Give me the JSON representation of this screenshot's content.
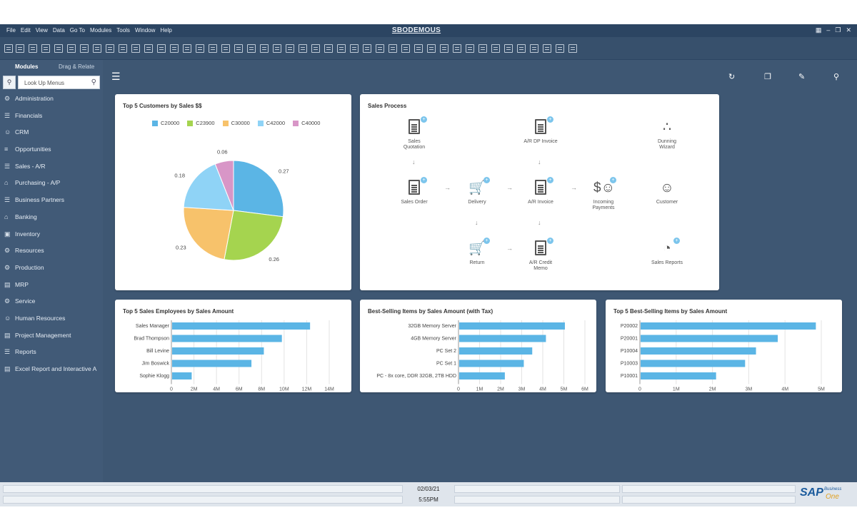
{
  "window": {
    "title": "SBODEMOUS",
    "menu": [
      "File",
      "Edit",
      "View",
      "Data",
      "Go To",
      "Modules",
      "Tools",
      "Window",
      "Help"
    ]
  },
  "sidebar": {
    "tabs": [
      "Modules",
      "Drag & Relate"
    ],
    "search_placeholder": "Look Up Menus",
    "items": [
      {
        "label": "Administration",
        "icon": "gear-icon"
      },
      {
        "label": "Financials",
        "icon": "ledger-icon"
      },
      {
        "label": "CRM",
        "icon": "people-icon"
      },
      {
        "label": "Opportunities",
        "icon": "chart-icon"
      },
      {
        "label": "Sales - A/R",
        "icon": "sales-icon"
      },
      {
        "label": "Purchasing - A/P",
        "icon": "cart-icon"
      },
      {
        "label": "Business Partners",
        "icon": "partners-icon"
      },
      {
        "label": "Banking",
        "icon": "bank-icon"
      },
      {
        "label": "Inventory",
        "icon": "box-icon"
      },
      {
        "label": "Resources",
        "icon": "resources-icon"
      },
      {
        "label": "Production",
        "icon": "production-icon"
      },
      {
        "label": "MRP",
        "icon": "mrp-icon"
      },
      {
        "label": "Service",
        "icon": "service-icon"
      },
      {
        "label": "Human Resources",
        "icon": "person-icon"
      },
      {
        "label": "Project Management",
        "icon": "project-icon"
      },
      {
        "label": "Reports",
        "icon": "report-icon"
      },
      {
        "label": "Excel Report and Interactive A",
        "icon": "excel-icon"
      }
    ]
  },
  "cards": {
    "pie": {
      "title": "Top 5 Customers by Sales $$"
    },
    "process": {
      "title": "Sales Process"
    },
    "employees": {
      "title": "Top 5 Sales Employees by Sales Amount"
    },
    "items_tax": {
      "title": "Best-Selling Items by Sales Amount (with Tax)"
    },
    "items": {
      "title": "Top 5 Best-Selling Items by Sales Amount"
    }
  },
  "process": {
    "nodes": [
      {
        "id": "quotation",
        "label": "Sales\nQuotation",
        "icon": "document-icon"
      },
      {
        "id": "ardp",
        "label": "A/R DP Invoice",
        "icon": "dollar-document-icon"
      },
      {
        "id": "dunning",
        "label": "Dunning\nWizard",
        "icon": "dunning-icon"
      },
      {
        "id": "order",
        "label": "Sales Order",
        "icon": "document-icon"
      },
      {
        "id": "delivery",
        "label": "Delivery",
        "icon": "cart-icon"
      },
      {
        "id": "arinvoice",
        "label": "A/R Invoice",
        "icon": "dollar-document-icon"
      },
      {
        "id": "incoming",
        "label": "Incoming\nPayments",
        "icon": "payment-icon"
      },
      {
        "id": "customer",
        "label": "Customer",
        "icon": "customer-icon"
      },
      {
        "id": "return",
        "label": "Return",
        "icon": "cart-return-icon"
      },
      {
        "id": "credit",
        "label": "A/R Credit\nMemo",
        "icon": "calendar-document-icon"
      },
      {
        "id": "reports",
        "label": "Sales Reports",
        "icon": "pie-report-icon"
      }
    ]
  },
  "status": {
    "date": "02/03/21",
    "time": "5:55PM"
  },
  "brand": {
    "sap": "SAP",
    "business": "Business",
    "one": "One"
  },
  "colors": {
    "bar": "#5bb5e5",
    "pie": [
      "#5bb5e5",
      "#a5d44f",
      "#f7c26b",
      "#8fd3f6",
      "#d896c7"
    ]
  },
  "chart_data": [
    {
      "type": "pie",
      "title": "Top 5 Customers by Sales $$",
      "categories": [
        "C20000",
        "C23900",
        "C30000",
        "C42000",
        "C40000"
      ],
      "values": [
        0.27,
        0.26,
        0.23,
        0.18,
        0.06
      ],
      "labels": [
        "0.27",
        "0.26",
        "0.23",
        "0.18",
        "0.06"
      ],
      "legend": "top"
    },
    {
      "type": "bar",
      "orientation": "horizontal",
      "title": "Top 5 Sales Employees by Sales Amount",
      "categories": [
        "Sales Manager",
        "Brad Thompson",
        "Bill Levine",
        "Jim Boswick",
        "Sophie Klogg"
      ],
      "values": [
        12300000,
        9800000,
        8200000,
        7100000,
        1800000
      ],
      "xlim": [
        0,
        14000000
      ],
      "ticks": [
        "0",
        "2M",
        "4M",
        "6M",
        "8M",
        "10M",
        "12M",
        "14M"
      ],
      "grid": true
    },
    {
      "type": "bar",
      "orientation": "horizontal",
      "title": "Best-Selling Items by Sales Amount (with Tax)",
      "categories": [
        "32GB Memory Server",
        "4GB Memory Server",
        "PC Set 2",
        "PC Set 1",
        "PC - 8x core, DDR 32GB, 2TB HDD"
      ],
      "values": [
        5050000,
        4150000,
        3500000,
        3100000,
        2200000
      ],
      "xlim": [
        0,
        6000000
      ],
      "ticks": [
        "0",
        "1M",
        "2M",
        "3M",
        "4M",
        "5M",
        "6M"
      ],
      "grid": true
    },
    {
      "type": "bar",
      "orientation": "horizontal",
      "title": "Top 5 Best-Selling Items by Sales Amount",
      "categories": [
        "P20002",
        "P20001",
        "P10004",
        "P10003",
        "P10001"
      ],
      "values": [
        4850000,
        3800000,
        3200000,
        2900000,
        2100000
      ],
      "xlim": [
        0,
        5000000
      ],
      "ticks": [
        "0",
        "1M",
        "2M",
        "3M",
        "4M",
        "5M"
      ],
      "grid": true
    }
  ]
}
